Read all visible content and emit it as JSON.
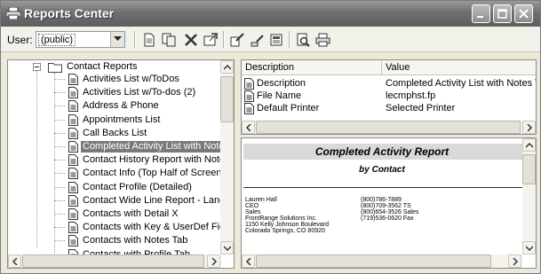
{
  "window": {
    "title": "Reports Center",
    "title_icon": "printer-icon"
  },
  "toolbar": {
    "user_label": "User:",
    "user_value": "(public)",
    "icons": [
      "new-report-icon",
      "copy-report-icon",
      "delete-icon",
      "properties-icon",
      "design-icon",
      "edit-icon",
      "view-icon",
      "print-preview-icon",
      "print-icon"
    ]
  },
  "tree": {
    "root_label": "Contact Reports",
    "items": [
      "Activities List w/ToDos",
      "Activities List w/To-dos (2)",
      "Address & Phone",
      "Appointments List",
      "Call Backs List",
      "Completed Activity List with Notes T",
      "Contact History Report with Notes",
      "Contact Info (Top Half of Screen)",
      "Contact Profile (Detailed)",
      "Contact Wide Line Report - Landsca",
      "Contacts with Detail X",
      "Contacts with Key & UserDef Fields",
      "Contacts with Notes Tab",
      "Contacts with Profile Tab"
    ],
    "selected_index": 5
  },
  "properties": {
    "headers": [
      "Description",
      "Value"
    ],
    "rows": [
      {
        "name": "Description",
        "value": "Completed Activity List with Notes Tab"
      },
      {
        "name": "File Name",
        "value": "lecmphst.fp"
      },
      {
        "name": "Default Printer",
        "value": "Selected Printer"
      }
    ]
  },
  "preview": {
    "title": "Completed Activity Report",
    "subtitle": "by Contact",
    "left_lines": [
      "Lauren Hall",
      "CEO",
      "Sales",
      "FrontRange Solutions Inc.",
      "1150 Kelly Johnson Boulevard",
      "Colorado Springs, CO 80920"
    ],
    "right_lines": [
      "(800)786-7889",
      "(800)709-3562  TS",
      "(800)654-3526  Sales",
      "(719)536-0620  Fax"
    ]
  },
  "colors": {
    "selection": "#7a7a7a",
    "titlebar": "#6e6e6e",
    "toolbar_bg": "#f2f1ea"
  }
}
